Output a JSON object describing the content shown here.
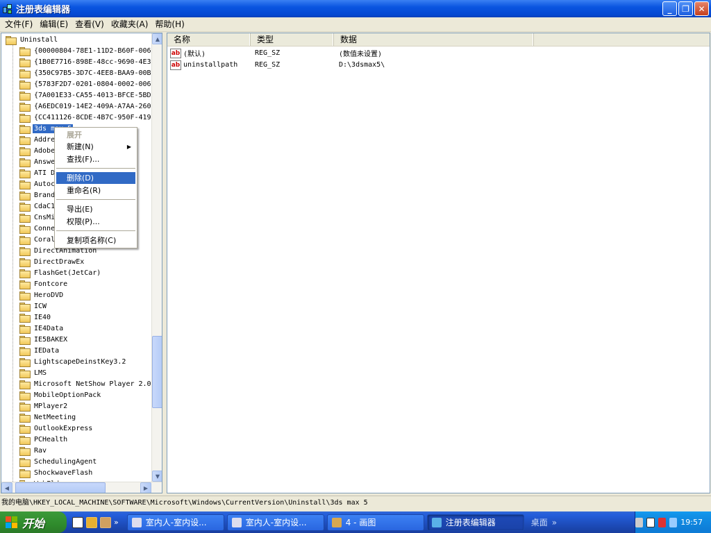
{
  "window": {
    "title": "注册表编辑器",
    "minimize_label": "_",
    "restore_label": "❐",
    "close_label": "✕"
  },
  "menu": [
    "文件(F)",
    "编辑(E)",
    "查看(V)",
    "收藏夹(A)",
    "帮助(H)"
  ],
  "tree": {
    "root": "Uninstall",
    "items": [
      "{00000804-78E1-11D2-B60F-006",
      "{1B0E7716-898E-48cc-9690-4E3",
      "{350C97B5-3D7C-4EE8-BAA9-00B",
      "{5783F2D7-0201-0804-0002-006",
      "{7A001E33-CA55-4013-BFCE-5BD",
      "{A6EDC019-14E2-409A-A7AA-260",
      "{CC411126-8CDE-4B7C-950F-419",
      "3ds max 5",
      "Addre",
      "Adobe",
      "Answe",
      "ATI D",
      "Autoc",
      "Brand",
      "CdaC1",
      "CnsMi",
      "Conne",
      "Coral",
      "DirectAnimation",
      "DirectDrawEx",
      "FlashGet(JetCar)",
      "Fontcore",
      "HeroDVD",
      "ICW",
      "IE40",
      "IE4Data",
      "IE5BAKEX",
      "IEData",
      "LightscapeDeinstKey3.2",
      "LMS",
      "Microsoft NetShow Player 2.0",
      "MobileOptionPack",
      "MPlayer2",
      "NetMeeting",
      "OutlookExpress",
      "PCHealth",
      "Rav",
      "SchedulingAgent",
      "ShockwaveFlash",
      "WebFldrs"
    ],
    "selected_index": 7
  },
  "context_menu": {
    "expand": "展开",
    "new": "新建(N)",
    "find": "查找(F)...",
    "delete": "删除(D)",
    "rename": "重命名(R)",
    "export": "导出(E)",
    "permissions": "权限(P)...",
    "copy_key_name": "复制项名称(C)"
  },
  "list": {
    "columns": [
      "名称",
      "类型",
      "数据"
    ],
    "rows": [
      {
        "name": "(默认)",
        "type": "REG_SZ",
        "data": "(数值未设置)"
      },
      {
        "name": "uninstallpath",
        "type": "REG_SZ",
        "data": "D:\\3dsmax5\\"
      }
    ]
  },
  "status": "我的电脑\\HKEY_LOCAL_MACHINE\\SOFTWARE\\Microsoft\\Windows\\CurrentVersion\\Uninstall\\3ds max 5",
  "taskbar": {
    "start": "开始",
    "quick_launch_more": "»",
    "tasks": [
      {
        "label": "室内人-室内设...",
        "active": false
      },
      {
        "label": "室内人-室内设...",
        "active": false
      },
      {
        "label": "4 - 画图",
        "active": false
      },
      {
        "label": "注册表编辑器",
        "active": true
      }
    ],
    "desktop": "桌面",
    "desktop_more": "»",
    "clock": "19:57"
  },
  "colors": {
    "selection": "#316ac5",
    "title_bar": "#0a55e0",
    "taskbar": "#245edb",
    "start_button": "#2f8b2c"
  }
}
